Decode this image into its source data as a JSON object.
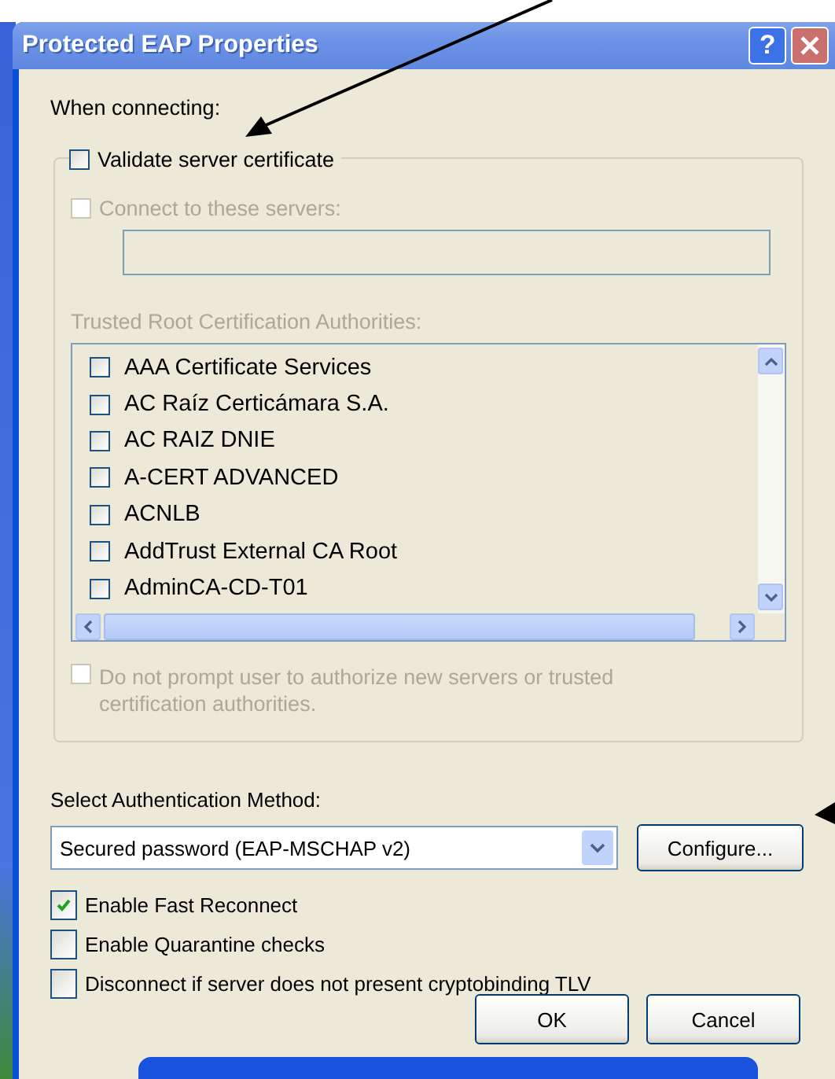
{
  "window": {
    "title": "Protected EAP Properties",
    "help_button": "?"
  },
  "when_connecting_label": "When connecting:",
  "validate_server_certificate": {
    "label": "Validate server certificate",
    "checked": false,
    "disabled": false
  },
  "connect_to_servers": {
    "label": "Connect to these servers:",
    "checked": false,
    "disabled": true
  },
  "trusted_root_label": "Trusted Root Certification Authorities:",
  "certificates": [
    {
      "label": "AAA Certificate Services",
      "checked": false
    },
    {
      "label": "AC Raíz Certicámara S.A.",
      "checked": false
    },
    {
      "label": "AC RAIZ DNIE",
      "checked": false
    },
    {
      "label": "A-CERT ADVANCED",
      "checked": false
    },
    {
      "label": "ACNLB",
      "checked": false
    },
    {
      "label": "AddTrust External CA Root",
      "checked": false
    },
    {
      "label": "AdminCA-CD-T01",
      "checked": false
    }
  ],
  "do_not_prompt": {
    "label": "Do not prompt user to authorize new servers or trusted certification authorities.",
    "checked": false,
    "disabled": true
  },
  "method_label": "Select Authentication Method:",
  "method_select": {
    "value": "Secured password (EAP-MSCHAP v2)"
  },
  "configure_button": "Configure...",
  "options": [
    {
      "label": "Enable Fast Reconnect",
      "checked": true
    },
    {
      "label": "Enable Quarantine checks",
      "checked": false
    },
    {
      "label": "Disconnect if server does not present cryptobinding TLV",
      "checked": false
    }
  ],
  "buttons": [
    "OK",
    "Cancel"
  ]
}
